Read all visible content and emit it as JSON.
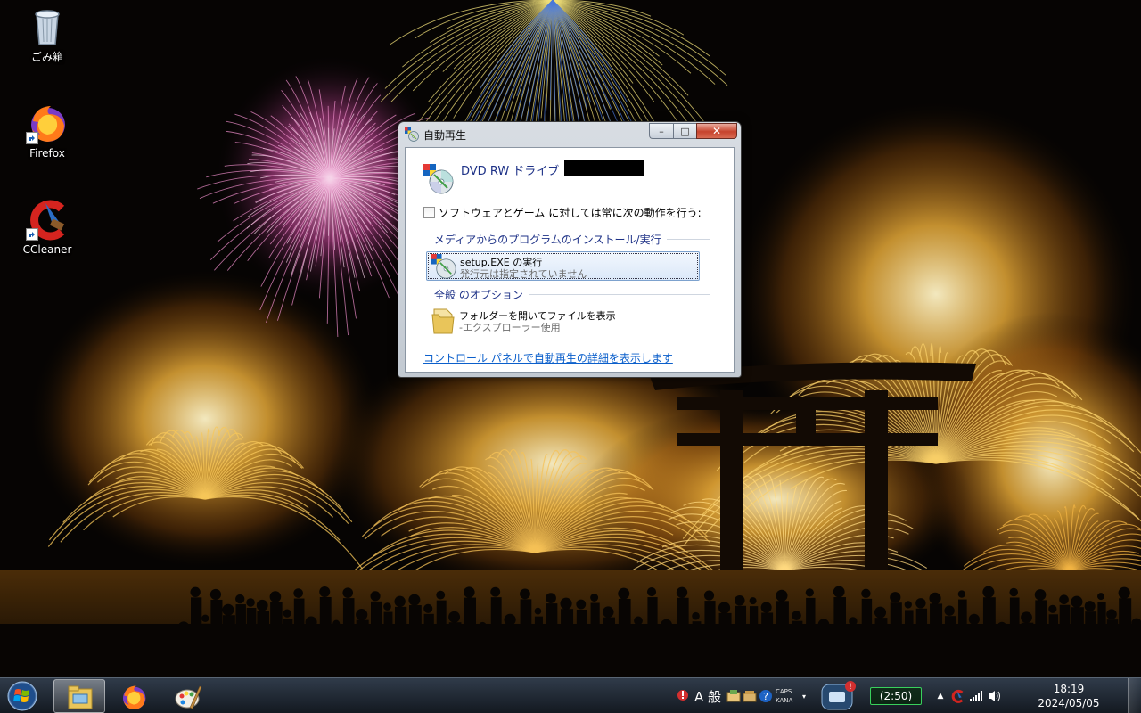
{
  "desktop": {
    "icons": [
      {
        "label": "ごみ箱",
        "icon": "recycle-bin-icon"
      },
      {
        "label": "Firefox",
        "icon": "firefox-icon"
      },
      {
        "label": "CCleaner",
        "icon": "ccleaner-icon"
      }
    ]
  },
  "dialog": {
    "title": "自動再生",
    "drive_name": "DVD RW ドライブ",
    "always_label": "ソフトウェアとゲーム に対しては常に次の動作を行う:",
    "always_checked": false,
    "group_install": "メディアからのプログラムのインストール/実行",
    "option_setup": {
      "title": "setup.EXE の実行",
      "subtitle": "発行元は指定されていません"
    },
    "group_general": "全般 のオプション",
    "option_folder": {
      "title": "フォルダーを開いてファイルを表示",
      "subtitle": "-エクスプローラー使用"
    },
    "control_panel_link": "コントロール パネルで自動再生の詳細を表示します",
    "caption_buttons": {
      "minimize": "–",
      "maximize": "□",
      "close": "✕"
    }
  },
  "taskbar": {
    "apps": [
      {
        "name": "explorer",
        "icon": "folder-icon",
        "active": true
      },
      {
        "name": "firefox",
        "icon": "firefox-icon",
        "active": false
      },
      {
        "name": "paint",
        "icon": "paint-palette-icon",
        "active": false
      }
    ],
    "tray": {
      "ime_mode": "A 般",
      "caps": "CAPS",
      "kana": "KANA",
      "battery": "(2:50)",
      "time": "18:19",
      "date": "2024/05/05"
    }
  },
  "colors": {
    "link": "#0b5fcb",
    "header_text": "#1e3287",
    "close_button": "#c7432d",
    "battery_border": "#39d05c"
  }
}
